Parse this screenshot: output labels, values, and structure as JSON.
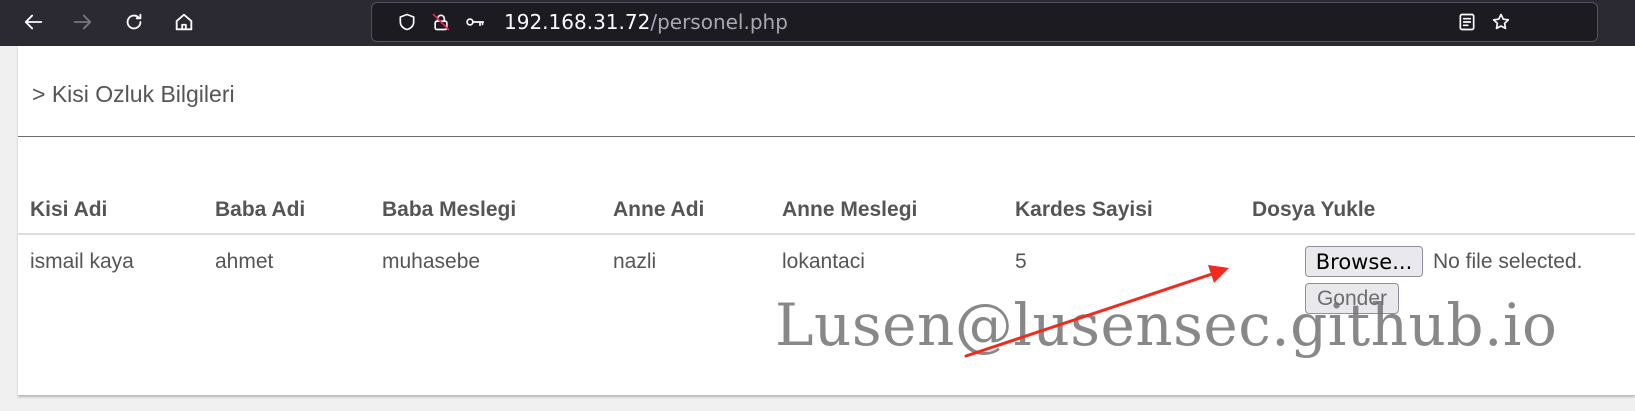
{
  "browser": {
    "url_host": "192.168.31.72",
    "url_path": "/personel.php",
    "icons": [
      "back-icon",
      "forward-icon",
      "reload-icon",
      "home-icon",
      "shield-icon",
      "insecure-lock-icon",
      "key-icon",
      "reader-view-icon",
      "bookmark-star-icon"
    ]
  },
  "page": {
    "section_title": "> Kisi Ozluk Bilgileri",
    "table": {
      "headers": [
        "Kisi Adi",
        "Baba Adi",
        "Baba Meslegi",
        "Anne Adi",
        "Anne Meslegi",
        "Kardes Sayisi",
        "Dosya Yukle"
      ],
      "row": [
        "ismail kaya",
        "ahmet",
        "muhasebe",
        "nazli",
        "lokantaci",
        "5"
      ]
    },
    "upload": {
      "browse_label": "Browse...",
      "no_file_text": "No file selected.",
      "submit_label": "Gonder"
    }
  },
  "watermark": "Lusen@lusensec.github.io",
  "colors": {
    "toolbar_bg": "#2b2a33",
    "urlbar_bg": "#1c1b22",
    "arrow": "#f02a1e"
  }
}
